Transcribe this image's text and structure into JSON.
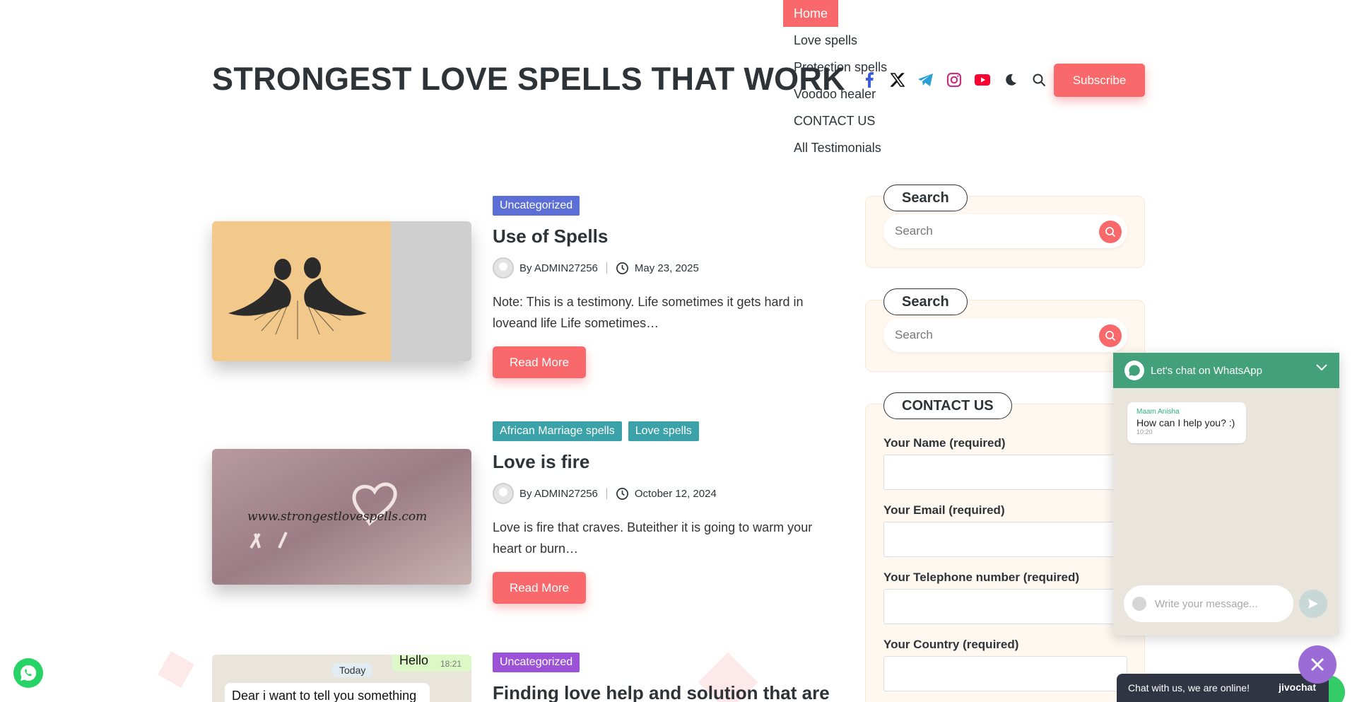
{
  "header": {
    "site_title": "STRONGEST LOVE SPELLS THAT WORK",
    "nav": [
      {
        "label": "Home",
        "active": true
      },
      {
        "label": "Love spells"
      },
      {
        "label": "Protection spells"
      },
      {
        "label": "Voodoo healer"
      },
      {
        "label": "CONTACT US"
      },
      {
        "label": "All Testimonials"
      }
    ],
    "socials": [
      "facebook-icon",
      "x-icon",
      "telegram-icon",
      "instagram-icon",
      "youtube-icon",
      "dark-mode-icon",
      "search-icon"
    ],
    "subscribe_label": "Subscribe"
  },
  "posts": [
    {
      "categories": [
        {
          "label": "Uncategorized",
          "color": "#5b6fd6"
        }
      ],
      "title": "Use of Spells",
      "author": "By ADMIN27256",
      "date": "May 23, 2025",
      "excerpt": "Note: This is a testimony. Life sometimes it gets hard in loveand life Life sometimes…",
      "read_more": "Read More"
    },
    {
      "categories": [
        {
          "label": "African Marriage spells",
          "color": "#3aa2a8"
        },
        {
          "label": "Love spells",
          "color": "#3aa2a8"
        }
      ],
      "title": "Love is fire",
      "author": "By ADMIN27256",
      "date": "October 12, 2024",
      "excerpt": "Love is fire that craves. Buteither it is going to warm your heart or burn…",
      "read_more": "Read More",
      "thumb_text": "www.strongestlovespells.com"
    },
    {
      "categories": [
        {
          "label": "Uncategorized",
          "color": "#9b52d6"
        }
      ],
      "title": "Finding love help and solution that are",
      "thumb_chat": {
        "today": "Today",
        "hello": "Hello",
        "time": "18:21",
        "message": "Dear i want to tell you something"
      }
    }
  ],
  "sidebar": {
    "search1": {
      "title": "Search",
      "placeholder": "Search"
    },
    "search2": {
      "title": "Search",
      "placeholder": "Search"
    },
    "contact": {
      "title": "CONTACT US",
      "fields": [
        "Your Name (required)",
        "Your Email (required)",
        "Your Telephone number (required)",
        "Your Country (required)"
      ]
    }
  },
  "whatsapp": {
    "header": "Let's chat on WhatsApp",
    "sender": "Maam Anisha",
    "message": "How can I help you? :)",
    "time": "10:20",
    "input_placeholder": "Write your message..."
  },
  "jivo": {
    "status": "Chat with us, we are online!",
    "brand": "jivochat"
  },
  "colors": {
    "accent": "#f9686a",
    "whatsapp": "#25d366"
  }
}
